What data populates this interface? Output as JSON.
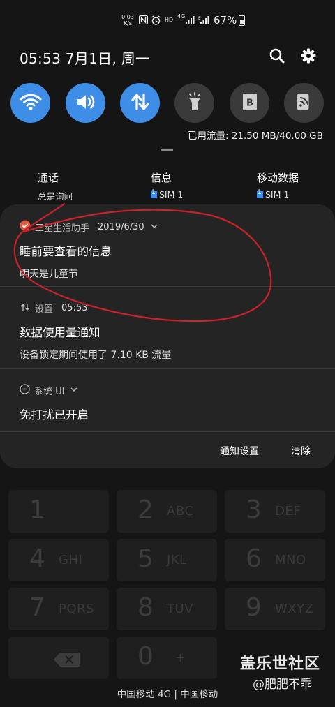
{
  "status_bar": {
    "net_speed_value": "0.03",
    "net_speed_unit": "K/s",
    "hd_label": "HD",
    "network_label": "4G",
    "battery_percent": "67%",
    "battery_level": 0.67
  },
  "header": {
    "datetime": "05:53  7月1日, 周一"
  },
  "quick_settings": {
    "toggles": [
      {
        "icon": "wifi-icon",
        "on": true
      },
      {
        "icon": "volume-icon",
        "on": true
      },
      {
        "icon": "mobile-data-icon",
        "on": true
      },
      {
        "icon": "flashlight-icon",
        "on": false
      },
      {
        "icon": "bixby-routine-icon",
        "on": false
      },
      {
        "icon": "nfc-icon",
        "on": false
      }
    ],
    "data_usage": "已用流量: 21.50 MB/40.00 GB"
  },
  "sim_settings": {
    "call": {
      "title": "通话",
      "value": "总是询问"
    },
    "messages": {
      "title": "信息",
      "value": "SIM 1"
    },
    "mobile_data": {
      "title": "移动数据",
      "value": "SIM 1"
    }
  },
  "notifications": [
    {
      "app": "三星生活助手",
      "time": "2019/6/30",
      "title": "睡前要查看的信息",
      "body": "明天是儿童节"
    },
    {
      "app": "设置",
      "time": "05:53",
      "title": "数据使用量通知",
      "body": "设备锁定期间使用了 7.10 KB 流量"
    },
    {
      "app": "系统 UI",
      "time": "",
      "title": "免打扰已开启",
      "body": ""
    }
  ],
  "notification_actions": {
    "settings": "通知设置",
    "clear": "清除"
  },
  "keypad": {
    "keys": [
      {
        "num": "1",
        "letters": ""
      },
      {
        "num": "2",
        "letters": "ABC"
      },
      {
        "num": "3",
        "letters": "DEF"
      },
      {
        "num": "4",
        "letters": "GHI"
      },
      {
        "num": "5",
        "letters": "JKL"
      },
      {
        "num": "6",
        "letters": "MNO"
      },
      {
        "num": "7",
        "letters": "PQRS"
      },
      {
        "num": "8",
        "letters": "TUV"
      },
      {
        "num": "9",
        "letters": "WXYZ"
      },
      {
        "num": "",
        "letters": ""
      },
      {
        "num": "0",
        "letters": "+"
      },
      {
        "num": "",
        "letters": ""
      }
    ]
  },
  "carrier": "中国移动 4G | 中国移动",
  "watermark": {
    "line1": "盖乐世社区",
    "line2": "@肥肥不乖"
  },
  "colors": {
    "accent": "#3e8ee8",
    "background": "#151515",
    "card": "#242424",
    "annotation": "#c8232a"
  }
}
